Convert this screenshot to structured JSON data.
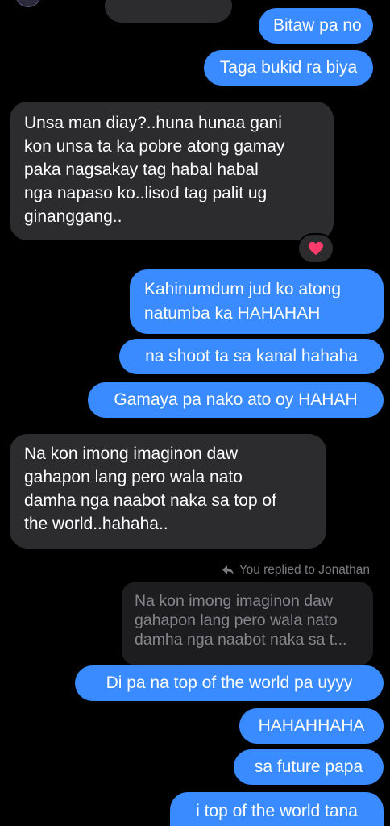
{
  "conversation": {
    "messages": [
      {
        "id": "m1",
        "side": "out",
        "lines": [
          "Bitaw pa no"
        ]
      },
      {
        "id": "m2",
        "side": "out",
        "lines": [
          "Taga bukid ra biya"
        ]
      },
      {
        "id": "m3",
        "side": "in",
        "lines": [
          "Unsa man diay?..huna hunaa gani",
          "kon unsa ta ka pobre atong gamay",
          "paka nagsakay tag habal habal",
          "nga napaso ko..lisod tag palit ug",
          "ginanggang.."
        ],
        "reaction": "heart-icon"
      },
      {
        "id": "m4",
        "side": "out",
        "lines": [
          "Kahinumdum jud ko atong",
          "natumba ka HAHAHAH"
        ]
      },
      {
        "id": "m5",
        "side": "out",
        "lines": [
          "na shoot ta sa kanal hahaha"
        ]
      },
      {
        "id": "m6",
        "side": "out",
        "lines": [
          "Gamaya pa nako ato oy HAHAH"
        ]
      },
      {
        "id": "m7",
        "side": "in",
        "lines": [
          "Na kon imong imaginon daw",
          "gahapon lang pero wala nato",
          "damha nga naabot naka sa top of",
          "the world..hahaha.."
        ]
      },
      {
        "id": "m8",
        "side": "out",
        "lines": [
          "Di pa na top of the world pa uyyy"
        ]
      },
      {
        "id": "m9",
        "side": "out",
        "lines": [
          "HAHAHHAHA"
        ]
      },
      {
        "id": "m10",
        "side": "out",
        "lines": [
          "sa future papa"
        ]
      },
      {
        "id": "m11",
        "side": "out",
        "lines": [
          "i top of the world tana"
        ]
      }
    ],
    "reply": {
      "label": "You replied to Jonathan",
      "quoted_lines": [
        "Na kon imong imaginon daw",
        "gahapon lang pero wala nato",
        "damha nga naabot naka sa t..."
      ]
    }
  },
  "colors": {
    "outgoing": "#3a8bff",
    "incoming": "#2c2c2e",
    "reaction_heart": "#ff3b6b"
  }
}
